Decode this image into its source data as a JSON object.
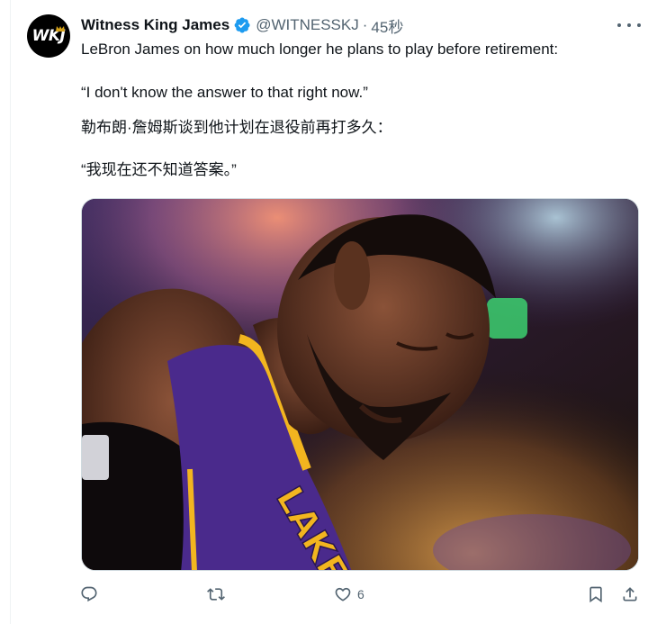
{
  "tweet": {
    "author": {
      "display_name": "Witness King James",
      "handle": "@WITNESSKJ",
      "avatar_text": "WKJ",
      "verified": true
    },
    "time": "45秒",
    "separator": "·",
    "lines": [
      "LeBron James on how much longer he plans to play before retirement:",
      "“I don't know the answer to that right now.”",
      "勒布朗·詹姆斯谈到他计划在退役前再打多久：",
      "“我现在还不知道答案。”"
    ],
    "media": {
      "icon": "photo-image",
      "jersey_text": "LAKERS"
    },
    "actions": {
      "reply": {
        "icon": "reply-icon",
        "count": ""
      },
      "retweet": {
        "icon": "retweet-icon",
        "count": ""
      },
      "like": {
        "icon": "heart-icon",
        "count": "6"
      },
      "bookmark": {
        "icon": "bookmark-icon"
      },
      "share": {
        "icon": "share-icon"
      }
    }
  },
  "colors": {
    "verified": "#1d9bf0",
    "secondary_text": "#536471",
    "lakers_purple": "#4a2a8c",
    "lakers_gold": "#f2b51f"
  }
}
